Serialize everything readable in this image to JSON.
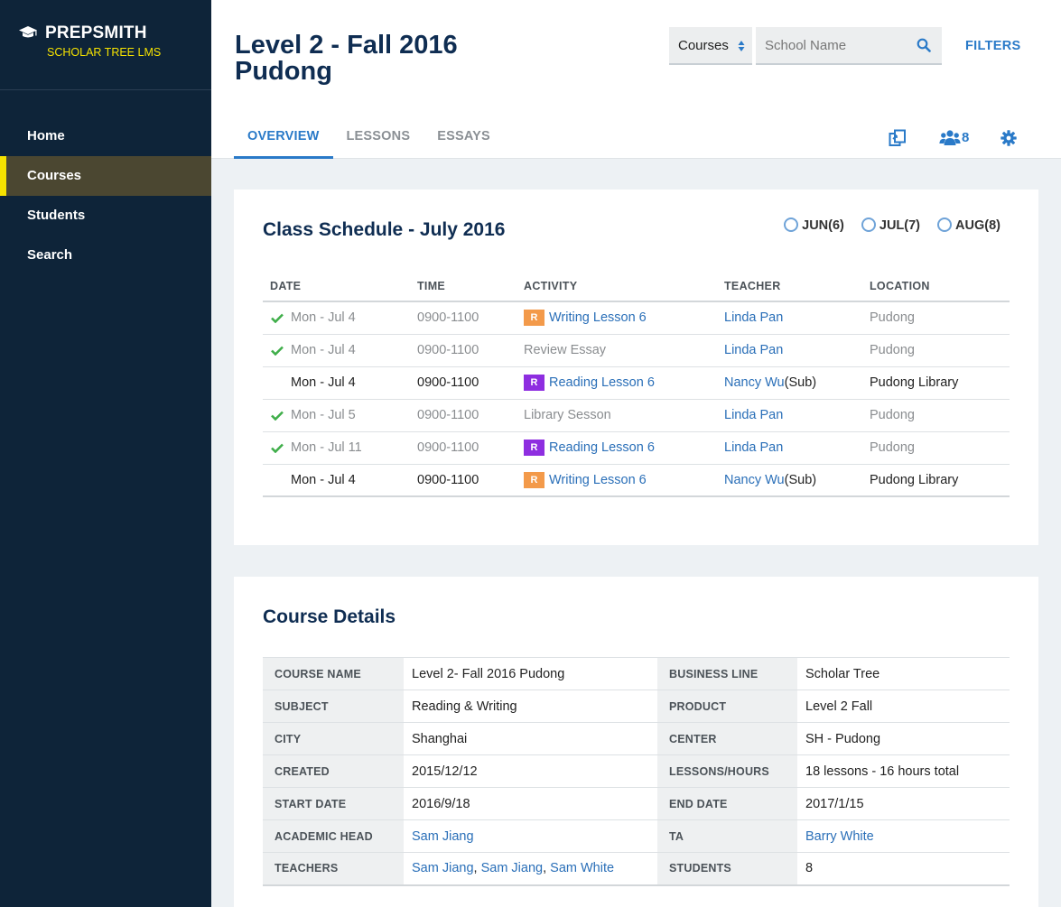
{
  "brand": {
    "name": "PREPSMITH",
    "subtitle": "SCHOLAR TREE LMS"
  },
  "sidebar": {
    "items": [
      {
        "label": "Home"
      },
      {
        "label": "Courses"
      },
      {
        "label": "Students"
      },
      {
        "label": "Search"
      }
    ],
    "active": "Courses"
  },
  "header": {
    "title": "Level 2 - Fall 2016 Pudong",
    "select_value": "Courses",
    "search_placeholder": "School Name",
    "filters_label": "FILTERS",
    "tabs": [
      {
        "label": "OVERVIEW"
      },
      {
        "label": "LESSONS"
      },
      {
        "label": "ESSAYS"
      }
    ],
    "active_tab": "OVERVIEW",
    "students_count": "8"
  },
  "schedule": {
    "title": "Class Schedule - July 2016",
    "months": [
      {
        "label": "JUN(6)"
      },
      {
        "label": "JUL(7)"
      },
      {
        "label": "AUG(8)"
      }
    ],
    "columns": {
      "date": "DATE",
      "time": "TIME",
      "activity": "ACTIVITY",
      "teacher": "TEACHER",
      "location": "LOCATION"
    },
    "rows": [
      {
        "date": "Mon - Jul 4",
        "time": "0900-1100",
        "badge": "R",
        "activity": "Writing Lesson 6",
        "teacher": "Linda Pan",
        "sub": "",
        "location": "Pudong"
      },
      {
        "date": "Mon - Jul 4",
        "time": "0900-1100",
        "badge": "",
        "activity": "Review Essay",
        "teacher": "Linda Pan",
        "sub": "",
        "location": "Pudong"
      },
      {
        "date": "Mon - Jul 4",
        "time": "0900-1100",
        "badge": "R",
        "activity": "Reading Lesson 6",
        "teacher": "Nancy Wu",
        "sub": "(Sub)",
        "location": "Pudong Library"
      },
      {
        "date": "Mon - Jul 5",
        "time": "0900-1100",
        "badge": "",
        "activity": "Library Sesson",
        "teacher": "Linda Pan",
        "sub": "",
        "location": "Pudong"
      },
      {
        "date": "Mon - Jul 11",
        "time": "0900-1100",
        "badge": "R",
        "activity": "Reading Lesson 6",
        "teacher": "Linda Pan",
        "sub": "",
        "location": "Pudong"
      },
      {
        "date": "Mon - Jul 4",
        "time": "0900-1100",
        "badge": "R",
        "activity": "Writing Lesson 6",
        "teacher": "Nancy Wu",
        "sub": "(Sub)",
        "location": "Pudong Library"
      }
    ]
  },
  "details": {
    "title": "Course Details",
    "rows": [
      {
        "l1": "COURSE NAME",
        "v1": "Level 2- Fall 2016 Pudong",
        "l2": "BUSINESS LINE",
        "v2": "Scholar Tree"
      },
      {
        "l1": "SUBJECT",
        "v1": "Reading & Writing",
        "l2": "PRODUCT",
        "v2": "Level 2 Fall"
      },
      {
        "l1": "CITY",
        "v1": "Shanghai",
        "l2": "CENTER",
        "v2": "SH - Pudong"
      },
      {
        "l1": "CREATED",
        "v1": "2015/12/12",
        "l2": "LESSONS/HOURS",
        "v2": "18 lessons - 16 hours total"
      },
      {
        "l1": "START DATE",
        "v1": "2016/9/18",
        "l2": "END DATE",
        "v2": "2017/1/15"
      },
      {
        "l1": "ACADEMIC HEAD",
        "v1": "Sam Jiang",
        "l2": "TA",
        "v2": "Barry White"
      },
      {
        "l1": "TEACHERS",
        "v1_links": [
          "Sam Jiang",
          "Sam Jiang",
          "Sam White"
        ],
        "v1_sep": ", ",
        "l2": "STUDENTS",
        "v2": "8"
      }
    ]
  },
  "colors": {
    "sidebar": "#0e2439",
    "accent": "#2a7ac8",
    "highlight": "#f5e200",
    "badge_writing": "#f39a4a",
    "badge_reading": "#8e2ee0",
    "check": "#3fae4a"
  }
}
